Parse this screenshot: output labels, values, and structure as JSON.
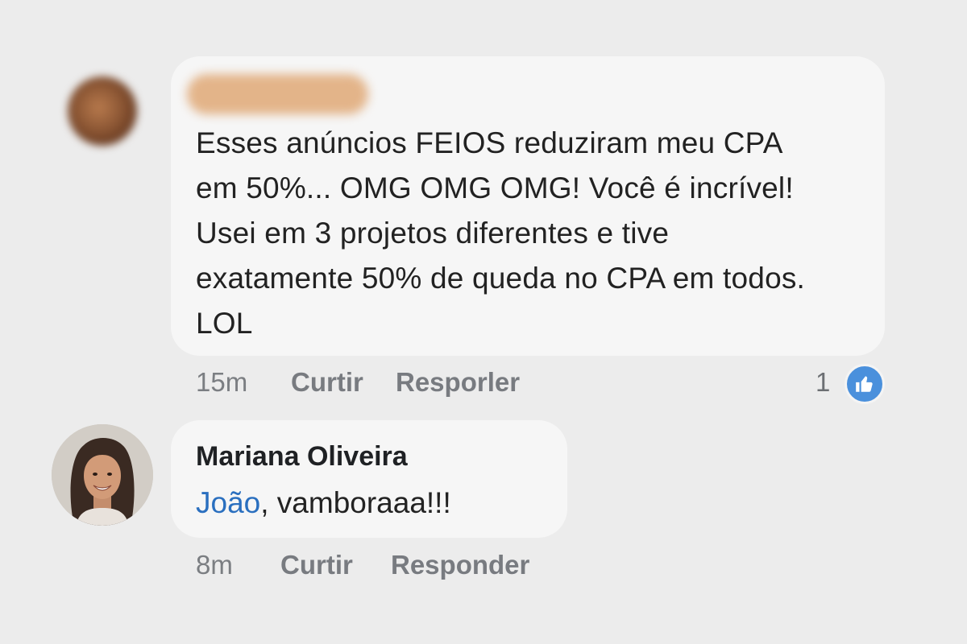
{
  "comments": [
    {
      "author_name": "",
      "text_lines": [
        "Esses anúncios FEIOS reduziram meu CPA",
        "em 50%... OMG OMG OMG! Você é incrível!",
        "Usei em 3 projetos diferentes e tive",
        "exatamente 50% de queda no CPA em todos.",
        "LOL"
      ],
      "time": "15m",
      "like_label": "Curtir",
      "reply_label": "Resporler",
      "reaction_count": "1",
      "reaction_icon": "thumbs-up-icon",
      "avatar": "blurred-avatar",
      "name_redacted": true
    },
    {
      "author_name": "Mariana Oliveira",
      "mention": "João",
      "text_rest": ", vamboraaa!!!",
      "time": "8m",
      "like_label": "Curtir",
      "reply_label": "Responder",
      "avatar": "user-photo-avatar"
    }
  ],
  "colors": {
    "background": "#ececec",
    "bubble": "#f6f6f6",
    "mention": "#2a6fbf",
    "like_badge": "#4a90dc",
    "meta_text": "#7b7e82"
  }
}
